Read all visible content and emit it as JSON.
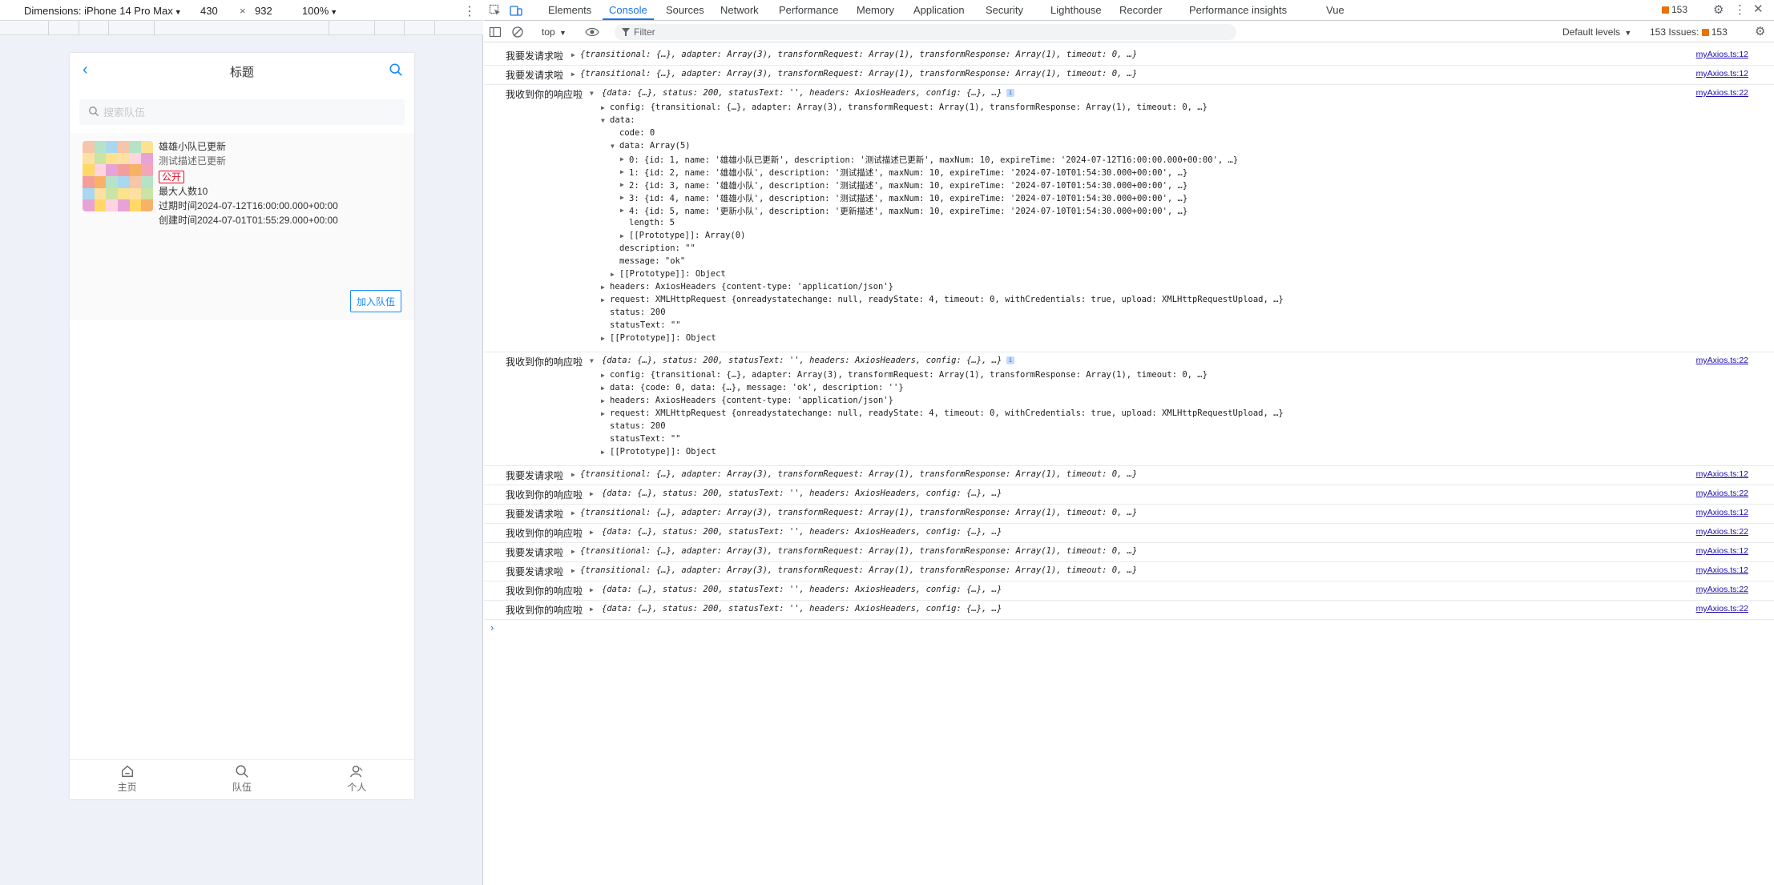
{
  "device_toolbar": {
    "dimensions_label": "Dimensions: iPhone 14 Pro Max",
    "width": "430",
    "times": "×",
    "height": "932",
    "zoom": "100%"
  },
  "app": {
    "title": "标题",
    "search_placeholder": "搜索队伍",
    "team": {
      "name": "雄雄小队已更新",
      "description": "测试描述已更新",
      "status_tag": "公开",
      "max_members": "最大人数10",
      "expire_time": "过期时间2024-07-12T16:00:00.000+00:00",
      "create_time": "创建时间2024-07-01T01:55:29.000+00:00",
      "join_label": "加入队伍"
    },
    "tabbar": [
      {
        "label": "主页",
        "icon": "home-icon"
      },
      {
        "label": "队伍",
        "icon": "search-icon"
      },
      {
        "label": "个人",
        "icon": "user-icon"
      }
    ]
  },
  "devtools": {
    "tabs": [
      "Elements",
      "Console",
      "Sources",
      "Network",
      "Performance",
      "Memory",
      "Application",
      "Security",
      "Lighthouse",
      "Recorder",
      "Performance insights",
      "Vue"
    ],
    "active_tab": "Console",
    "error_count": "153",
    "context": "top",
    "filter_placeholder": "Filter",
    "levels": "Default levels",
    "issues_label": "153 Issues:",
    "issues_count": "153",
    "accent_color": "#1a73e8"
  },
  "console": {
    "request_label": "我要发请求啦",
    "response_label": "我收到你的响应啦",
    "request_obj": "{transitional: {…}, adapter: Array(3), transformRequest: Array(1), transformResponse: Array(1), timeout: 0, …}",
    "response_obj": "{data: {…}, status: 200, statusText: '', headers: AxiosHeaders, config: {…}, …}",
    "src_request": "myAxios.ts:12",
    "src_response": "myAxios.ts:22",
    "expanded1": {
      "config": "config: {transitional: {…}, adapter: Array(3), transformRequest: Array(1), transformResponse: Array(1), timeout: 0, …}",
      "data": "data:",
      "code": "code: 0",
      "data_array": "data: Array(5)",
      "items": [
        "0: {id: 1, name: '雄雄小队已更新', description: '测试描述已更新', maxNum: 10, expireTime: '2024-07-12T16:00:00.000+00:00', …}",
        "1: {id: 2, name: '雄雄小队', description: '测试描述', maxNum: 10, expireTime: '2024-07-10T01:54:30.000+00:00', …}",
        "2: {id: 3, name: '雄雄小队', description: '测试描述', maxNum: 10, expireTime: '2024-07-10T01:54:30.000+00:00', …}",
        "3: {id: 4, name: '雄雄小队', description: '测试描述', maxNum: 10, expireTime: '2024-07-10T01:54:30.000+00:00', …}",
        "4: {id: 5, name: '更新小队', description: '更新描述', maxNum: 10, expireTime: '2024-07-10T01:54:30.000+00:00', …}"
      ],
      "length": "length: 5",
      "proto_array": "[[Prototype]]: Array(0)",
      "description": "description: \"\"",
      "message": "message: \"ok\"",
      "proto_obj_inner": "[[Prototype]]: Object",
      "headers": "headers: AxiosHeaders {content-type: 'application/json'}",
      "request": "request: XMLHttpRequest {onreadystatechange: null, readyState: 4, timeout: 0, withCredentials: true, upload: XMLHttpRequestUpload, …}",
      "status": "status: 200",
      "statusText": "statusText: \"\"",
      "proto_obj": "[[Prototype]]: Object"
    },
    "expanded2": {
      "config": "config: {transitional: {…}, adapter: Array(3), transformRequest: Array(1), transformResponse: Array(1), timeout: 0, …}",
      "data": "data: {code: 0, data: {…}, message: 'ok', description: ''}",
      "headers": "headers: AxiosHeaders {content-type: 'application/json'}",
      "request": "request: XMLHttpRequest {onreadystatechange: null, readyState: 4, timeout: 0, withCredentials: true, upload: XMLHttpRequestUpload, …}",
      "status": "status: 200",
      "statusText": "statusText: \"\"",
      "proto_obj": "[[Prototype]]: Object"
    }
  }
}
